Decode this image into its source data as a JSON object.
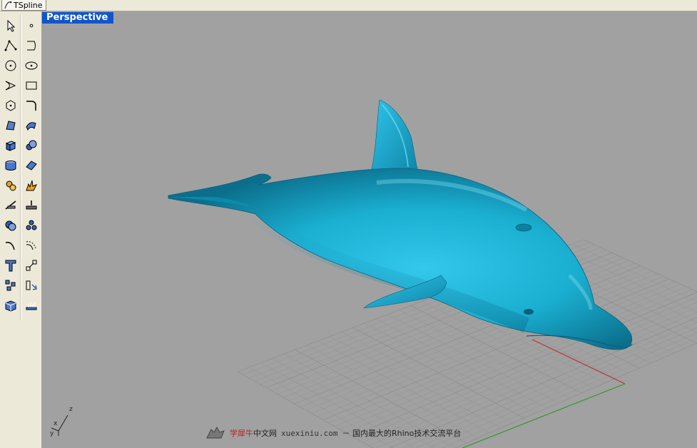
{
  "tab": {
    "label": "TSpline"
  },
  "viewport": {
    "title": "Perspective"
  },
  "axes": {
    "x": "x",
    "y": "y",
    "z": "z"
  },
  "watermark": {
    "brand": "学犀牛",
    "site": "中文网",
    "url": "xuexiniu.com",
    "tagline": "－ 国内最大的Rhino技术交流平台"
  },
  "colors": {
    "model": "#1aaed0",
    "viewport_title_bg": "#1155cc",
    "x_axis": "#c03030",
    "y_axis": "#2c9a2c",
    "background": "#a1a1a1"
  },
  "toolbar": {
    "left": [
      "select-arrow-icon",
      "polyline-icon",
      "circle-icon",
      "curve-icon",
      "polygon-icon",
      "surface-points-icon",
      "box-icon",
      "cylinder-icon",
      "gear-transform-icon",
      "trim-icon",
      "boolean-icon",
      "fillet-curve-icon",
      "text-icon",
      "group-icon",
      "view-cube-icon"
    ],
    "right": [
      "point-icon",
      "curve-arc-icon",
      "ellipse-icon",
      "rectangle-icon",
      "fillet-icon",
      "surface-icon",
      "sphere-icon",
      "plane-surface-icon",
      "explode-icon",
      "split-icon",
      "spheres-icon",
      "offset-curve-icon",
      "scale-icon",
      "mirror-icon",
      "measure-icon"
    ]
  }
}
